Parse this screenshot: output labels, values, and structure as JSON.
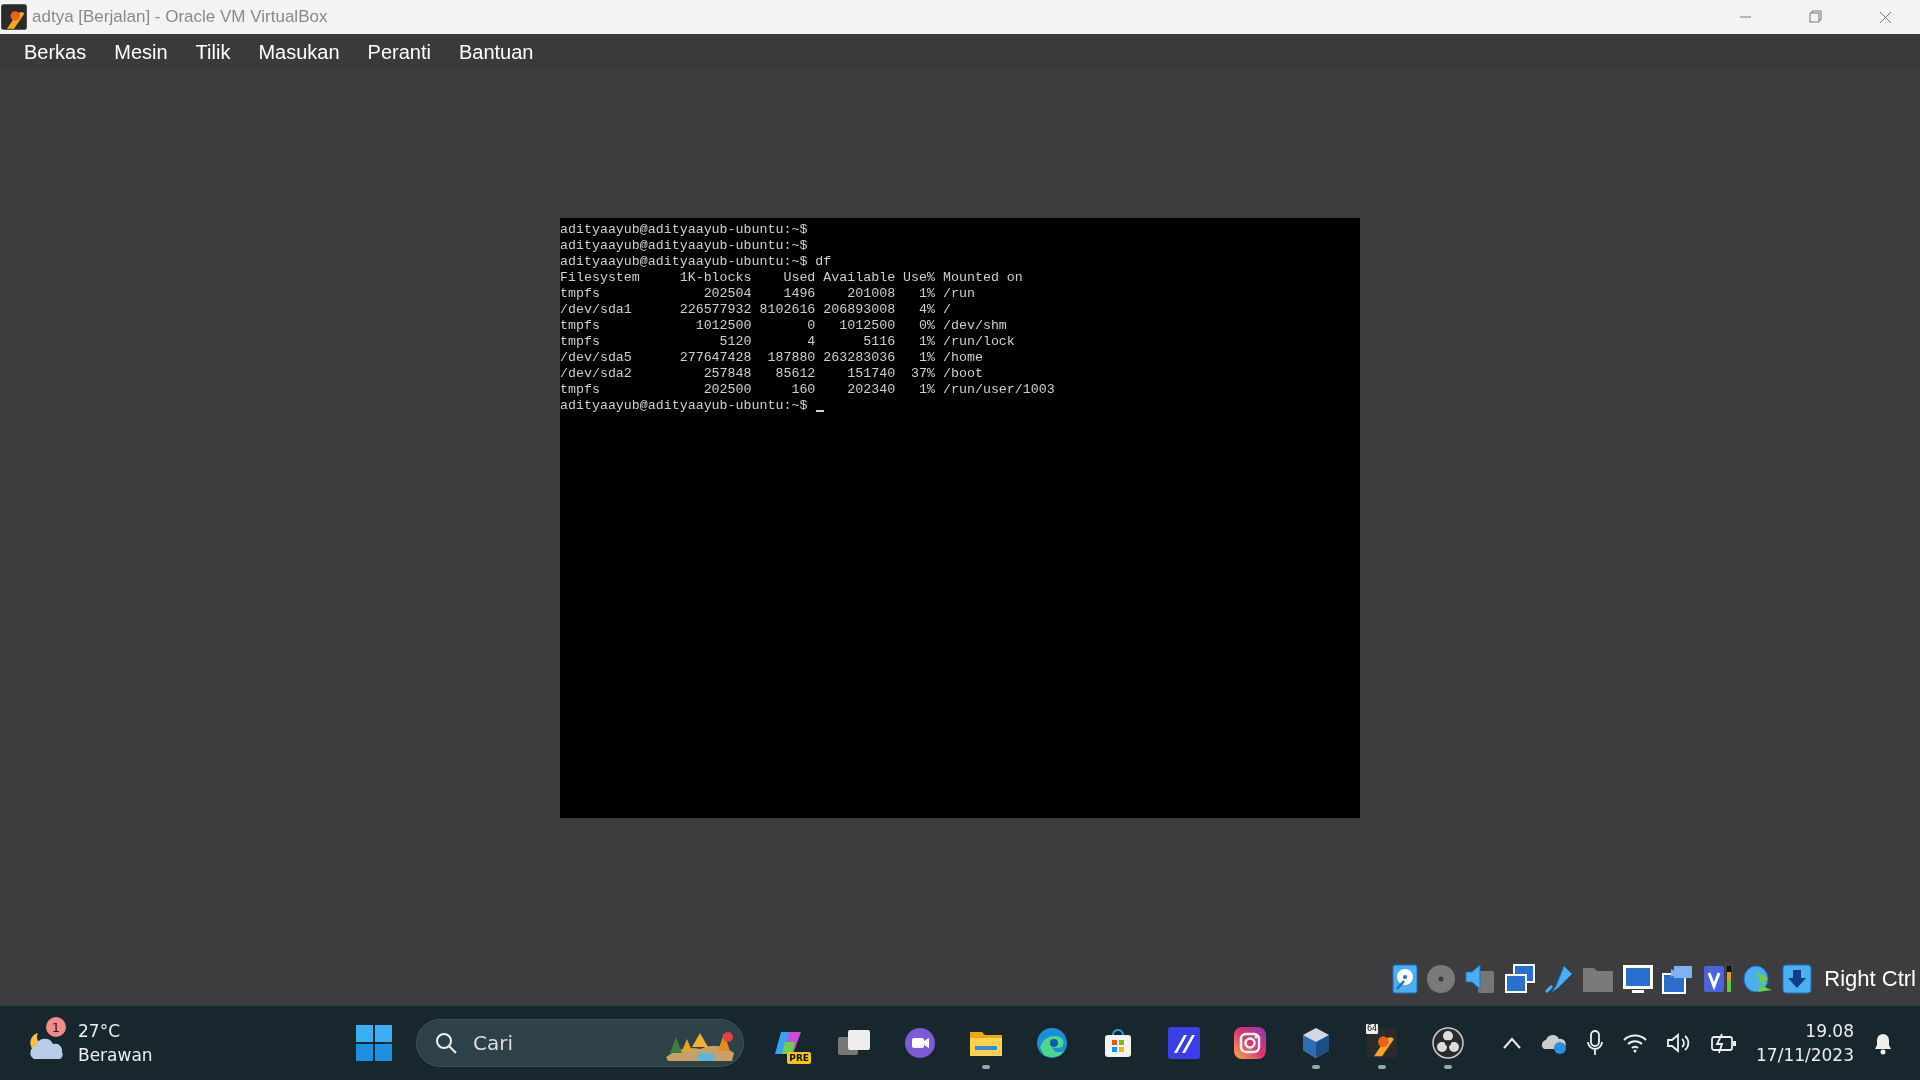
{
  "window": {
    "title": "adtya [Berjalan] - Oracle VM VirtualBox"
  },
  "menu": [
    "Berkas",
    "Mesin",
    "Tilik",
    "Masukan",
    "Peranti",
    "Bantuan"
  ],
  "terminal": {
    "lines": [
      "adityaayub@adityaayub-ubuntu:~$",
      "adityaayub@adityaayub-ubuntu:~$",
      "adityaayub@adityaayub-ubuntu:~$ df",
      "Filesystem     1K-blocks    Used Available Use% Mounted on",
      "tmpfs             202504    1496    201008   1% /run",
      "/dev/sda1      226577932 8102616 206893008   4% /",
      "tmpfs            1012500       0   1012500   0% /dev/shm",
      "tmpfs               5120       4      5116   1% /run/lock",
      "/dev/sda5      277647428  187880 263283036   1% /home",
      "/dev/sda2         257848   85612    151740  37% /boot",
      "tmpfs             202500     160    202340   1% /run/user/1003",
      "adityaayub@adityaayub-ubuntu:~$"
    ],
    "cursor_visible": true
  },
  "status_bar": {
    "host_key": "Right Ctrl"
  },
  "taskbar": {
    "weather": {
      "badge": "1",
      "temperature": "27°C",
      "condition": "Berawan"
    },
    "search": {
      "placeholder": "Cari"
    },
    "apps": [
      {
        "kind": "copilot",
        "running": false,
        "badge": "PRE"
      },
      {
        "kind": "taskview",
        "running": false
      },
      {
        "kind": "meet",
        "running": false
      },
      {
        "kind": "explorer",
        "running": true
      },
      {
        "kind": "edge",
        "running": false
      },
      {
        "kind": "store",
        "running": false
      },
      {
        "kind": "mark",
        "running": false
      },
      {
        "kind": "instagram",
        "running": false
      },
      {
        "kind": "cube",
        "running": true
      },
      {
        "kind": "vbox",
        "running": true,
        "badge": "64"
      },
      {
        "kind": "obs",
        "running": true
      }
    ],
    "time": "19.08",
    "date": "17/11/2023"
  }
}
